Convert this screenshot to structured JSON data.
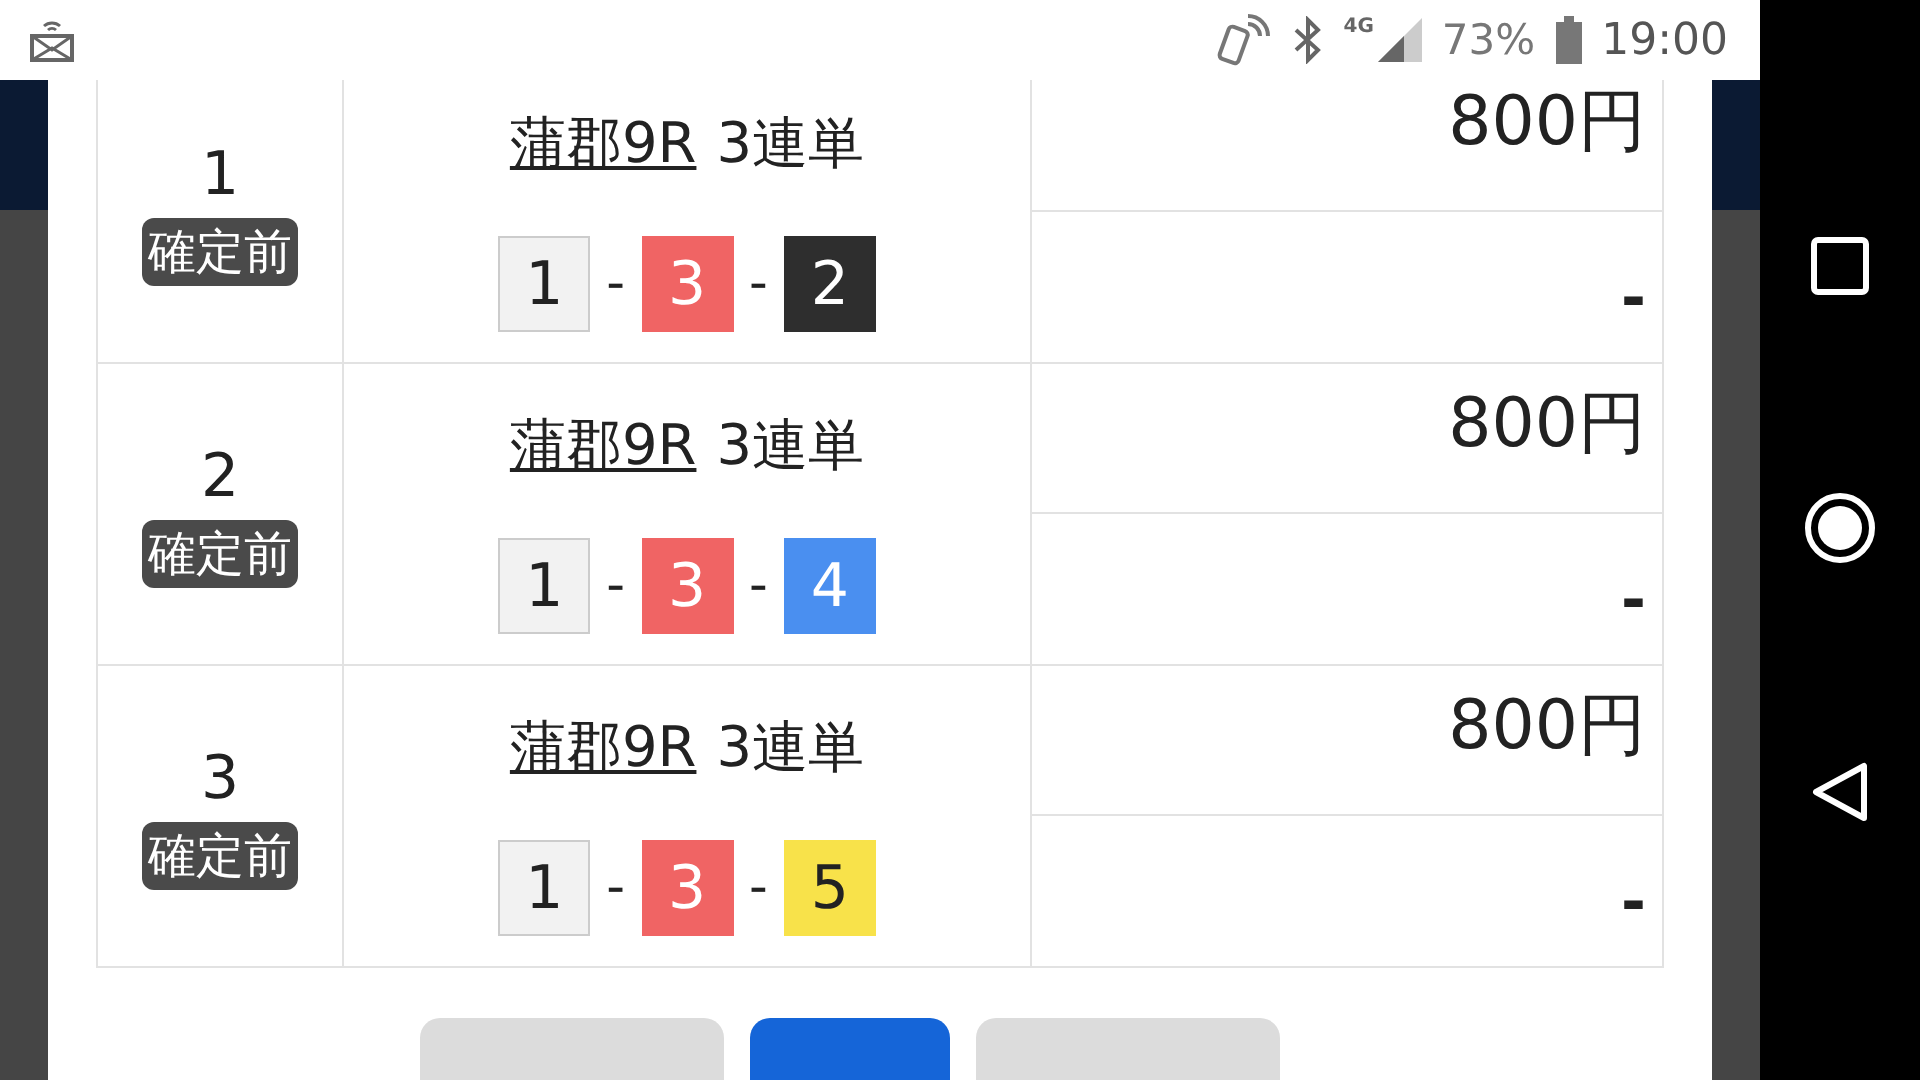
{
  "status_bar": {
    "network": "4G",
    "battery": "73%",
    "time": "19:00"
  },
  "bets": [
    {
      "number": "1",
      "status": "確定前",
      "race": "蒲郡9R",
      "bet_type": "3連単",
      "combination": [
        {
          "number": "1",
          "color": "#f2f2f2"
        },
        {
          "separator": "-",
          "number": "3",
          "color": "#f06464"
        },
        {
          "separator": "-",
          "number": "2",
          "color": "#2e2e2e"
        }
      ],
      "amount": "800円",
      "payout": "-"
    },
    {
      "number": "2",
      "status": "確定前",
      "race": "蒲郡9R",
      "bet_type": "3連単",
      "combination": [
        {
          "number": "1",
          "color": "#f2f2f2"
        },
        {
          "separator": "-",
          "number": "3",
          "color": "#f06464"
        },
        {
          "separator": "-",
          "number": "4",
          "color": "#4a8ff0"
        }
      ],
      "amount": "800円",
      "payout": "-"
    },
    {
      "number": "3",
      "status": "確定前",
      "race": "蒲郡9R",
      "bet_type": "3連単",
      "combination": [
        {
          "number": "1",
          "color": "#f2f2f2"
        },
        {
          "separator": "-",
          "number": "3",
          "color": "#f06464"
        },
        {
          "separator": "-",
          "number": "5",
          "color": "#f8e24a"
        }
      ],
      "amount": "800円",
      "payout": "-"
    }
  ],
  "buttons": [
    {
      "kind": "secondary"
    },
    {
      "kind": "primary"
    },
    {
      "kind": "secondary"
    }
  ]
}
